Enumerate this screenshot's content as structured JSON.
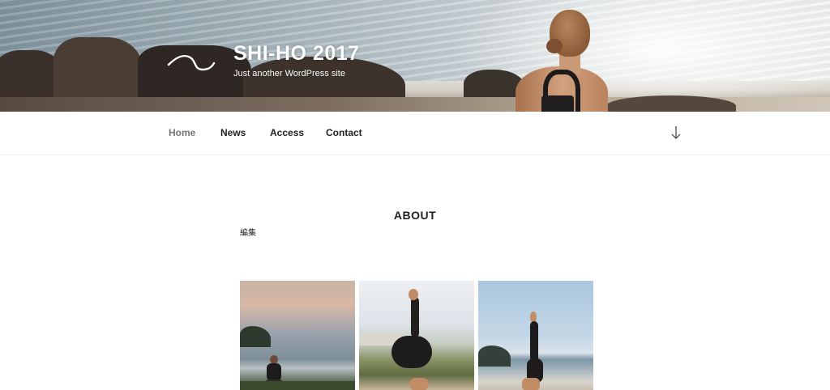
{
  "site": {
    "title": "SHI-HO 2017",
    "description": "Just another WordPress site"
  },
  "nav": {
    "items": [
      {
        "label": "Home",
        "current": true
      },
      {
        "label": "News",
        "current": false
      },
      {
        "label": "Access",
        "current": false
      },
      {
        "label": "Contact",
        "current": false
      }
    ],
    "scroll_icon": "arrow-down-icon"
  },
  "content": {
    "page_title": "ABOUT",
    "edit_link": "編集"
  },
  "gallery": {
    "images": [
      {
        "name": "yoga-sunset-beach-photo"
      },
      {
        "name": "yoga-handstand-hill-photo"
      },
      {
        "name": "yoga-handstand-beach-photo"
      }
    ]
  },
  "colors": {
    "nav_current": "#767676",
    "text": "#222222"
  }
}
